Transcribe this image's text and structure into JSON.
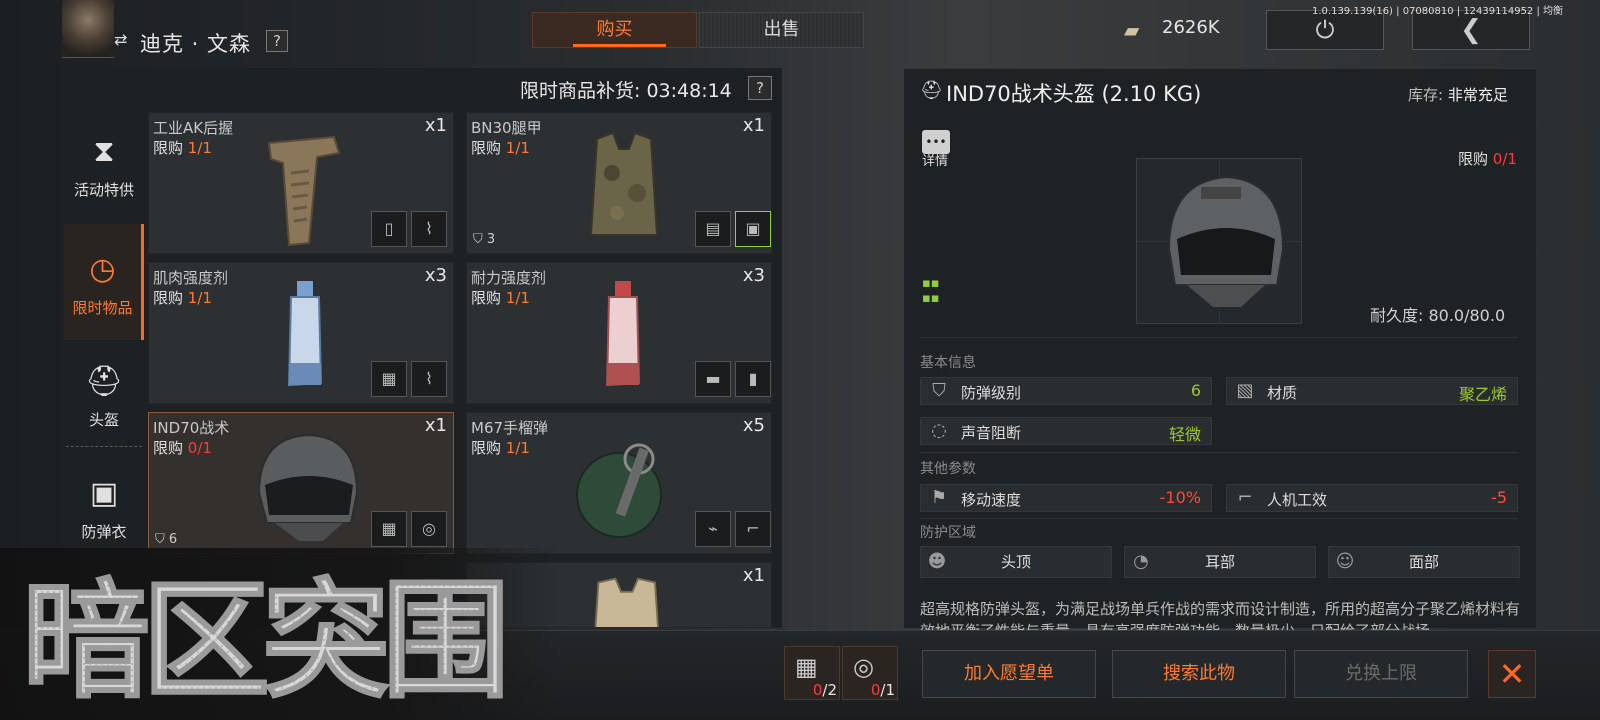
{
  "header": {
    "trader_name": "迪克 · 文森",
    "help": "?",
    "tabs": {
      "buy": "购买",
      "sell": "出售"
    },
    "money": "2626K",
    "build_info": "1.0.139.139(16) | 07080810 | 12439114952 | 均衡"
  },
  "left": {
    "restock": "限时商品补货: 03:48:14",
    "help": "?",
    "categories": [
      {
        "label": "活动特供",
        "icon": "hourglass-icon"
      },
      {
        "label": "限时物品",
        "icon": "clock-icon"
      },
      {
        "label": "头盔",
        "icon": "helmet-icon"
      },
      {
        "label": "防弹衣",
        "icon": "vest-icon"
      }
    ],
    "cards": [
      {
        "name": "工业AK后握",
        "limit_label": "限购",
        "limit": "1/1",
        "qty": "x1"
      },
      {
        "name": "BN30腿甲",
        "limit_label": "限购",
        "limit": "1/1",
        "qty": "x1",
        "badge": "3"
      },
      {
        "name": "肌肉强度剂",
        "limit_label": "限购",
        "limit": "1/1",
        "qty": "x3"
      },
      {
        "name": "耐力强度剂",
        "limit_label": "限购",
        "limit": "1/1",
        "qty": "x3"
      },
      {
        "name": "IND70战术",
        "limit_label": "限购",
        "limit": "0/1",
        "qty": "x1",
        "badge": "6"
      },
      {
        "name": "M67手榴弹",
        "limit_label": "限购",
        "limit": "1/1",
        "qty": "x5"
      },
      {
        "name": "",
        "limit_label": "",
        "limit": "",
        "qty": "x1"
      }
    ]
  },
  "detail": {
    "title": "IND70战术头盔 (2.10 KG)",
    "stock_label": "库存:",
    "stock_value": "非常充足",
    "detail_label": "详情",
    "limit_label": "限购",
    "limit_value": "0/1",
    "durability": "耐久度: 80.0/80.0",
    "section_basic": "基本信息",
    "section_other": "其他参数",
    "section_zone": "防护区域",
    "attrs": {
      "armor_level": {
        "label": "防弹级别",
        "value": "6"
      },
      "material": {
        "label": "材质",
        "value": "聚乙烯"
      },
      "sound_block": {
        "label": "声音阻断",
        "value": "轻微"
      },
      "move_speed": {
        "label": "移动速度",
        "value": "-10%"
      },
      "ergonomics": {
        "label": "人机工效",
        "value": "-5"
      }
    },
    "zones": [
      "头顶",
      "耳部",
      "面部"
    ],
    "description": "超高规格防弹头盔，为满足战场单兵作战的需求而设计制造，所用的超高分子聚乙烯材料有效地平衡了性能与重量，具有高强度防弹功能，数量极少，只配给了部分战场"
  },
  "bottom": {
    "cost1": {
      "have": "0",
      "need": "/2"
    },
    "cost2": {
      "have": "0",
      "need": "/1"
    },
    "wishlist": "加入愿望单",
    "search": "搜索此物",
    "exchange_limit": "兑换上限"
  },
  "logo_text": "暗区突围",
  "colors": {
    "accent": "#ff6a1a",
    "limit_red": "#ff3a3a",
    "positive": "#9acb2a"
  }
}
